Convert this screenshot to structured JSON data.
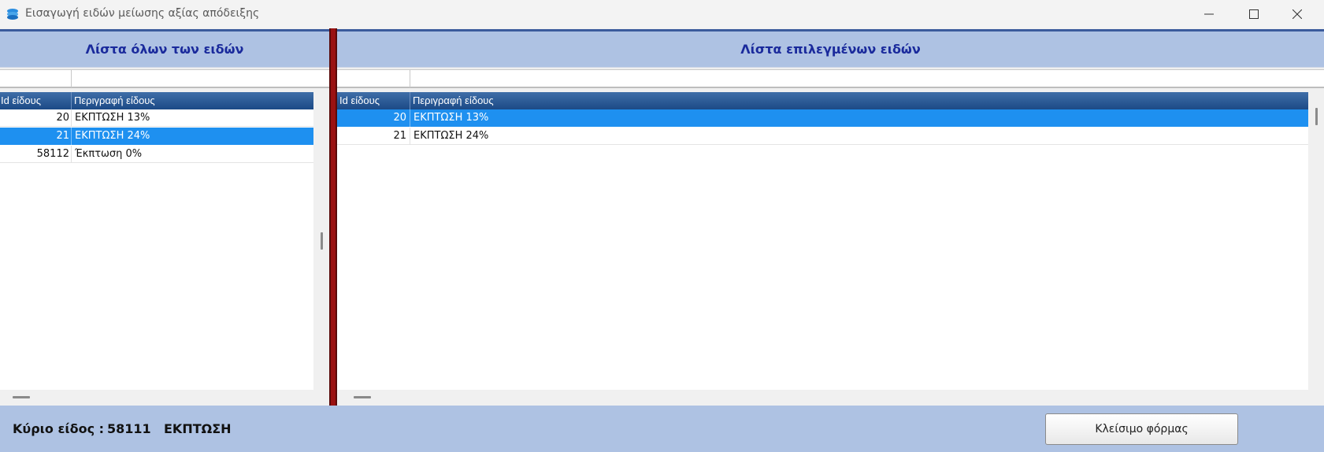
{
  "window": {
    "title": "Εισαγωγή ειδών μείωσης αξίας απόδειξης",
    "icon": "app-stack-icon"
  },
  "left_panel": {
    "header": "Λίστα όλων των ειδών",
    "filter": {
      "id_value": "",
      "desc_value": ""
    },
    "columns": {
      "id": "Id είδους",
      "description": "Περιγραφή είδους"
    },
    "rows": [
      {
        "id": "20",
        "description": "ΕΚΠΤΩΣΗ 13%",
        "selected": false
      },
      {
        "id": "21",
        "description": "ΕΚΠΤΩΣΗ 24%",
        "selected": true
      },
      {
        "id": "58112",
        "description": "Έκπτωση 0%",
        "selected": false
      }
    ]
  },
  "right_panel": {
    "header": "Λίστα επιλεγμένων ειδών",
    "filter": {
      "id_value": "",
      "desc_value": ""
    },
    "columns": {
      "id": "Id είδους",
      "description": "Περιγραφή είδους"
    },
    "rows": [
      {
        "id": "20",
        "description": "ΕΚΠΤΩΣΗ 13%",
        "selected": true
      },
      {
        "id": "21",
        "description": "ΕΚΠΤΩΣΗ 24%",
        "selected": false
      }
    ]
  },
  "footer": {
    "label": "Κύριο είδος :",
    "code": "58111",
    "name": "ΕΚΠΤΩΣΗ",
    "close_button": "Κλείσιμο φόρμας"
  },
  "colors": {
    "header_bg": "#aec2e3",
    "header_text": "#1a2a9c",
    "grid_header": "#1c4a86",
    "selection": "#1e90f0",
    "splitter": "#9a1212"
  }
}
